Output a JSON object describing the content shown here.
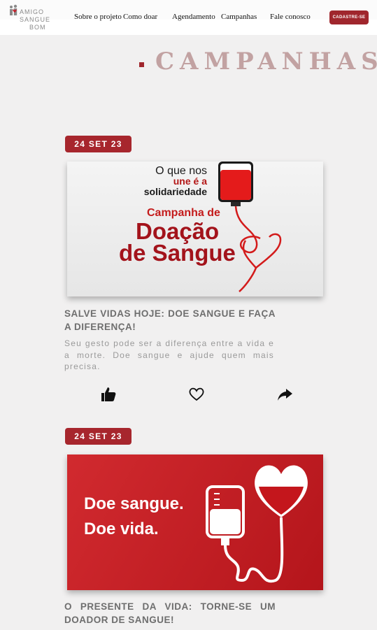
{
  "header": {
    "logo": {
      "line1": "AMIGO",
      "line2": "SANGUE",
      "line3": "BOM"
    },
    "nav": [
      {
        "label": "Sobre o projeto"
      },
      {
        "label": "Como doar"
      },
      {
        "label": "Agendamento"
      },
      {
        "label": "Campanhas"
      },
      {
        "label": "Fale conosco"
      }
    ],
    "cta_label": "CADASTRE-SE"
  },
  "section": {
    "title": "CAMPANHAS"
  },
  "posts": [
    {
      "date": "24 SET 23",
      "image": {
        "line1": "O que nos",
        "line2": "une é a",
        "line3": "solidariedade",
        "campaign": "Campanha de",
        "headline1": "Doação",
        "headline2": "de Sangue"
      },
      "title": "SALVE VIDAS HOJE: DOE SANGUE E FAÇA A DIFERENÇA!",
      "excerpt": "Seu gesto pode ser a diferença entre a vida e a morte. Doe sangue e ajude quem mais precisa.",
      "actions": [
        "like-icon",
        "heart-icon",
        "share-icon"
      ]
    },
    {
      "date": "24 SET 23",
      "image": {
        "line1": "Doe sangue.",
        "line2": "Doe vida."
      },
      "title": "O PRESENTE DA VIDA: TORNE-SE UM DOADOR DE SANGUE!"
    }
  ],
  "colors": {
    "brand": "#a7262d",
    "background": "#f1f0f0",
    "heading": "#c2a2a2"
  }
}
